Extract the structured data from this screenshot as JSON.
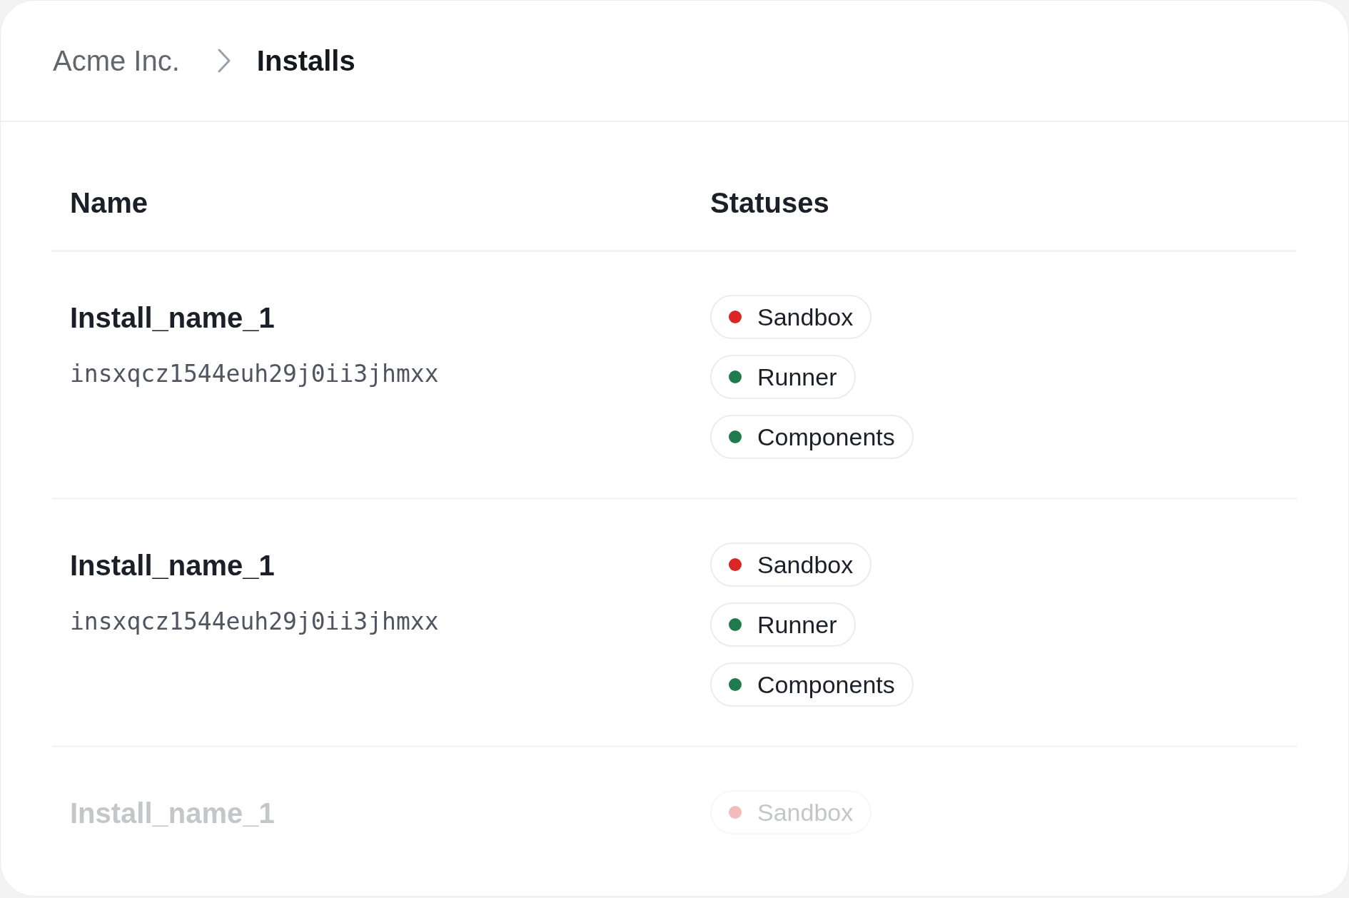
{
  "breadcrumb": {
    "parent": "Acme Inc.",
    "current": "Installs"
  },
  "table": {
    "columns": [
      "Name",
      "Statuses"
    ],
    "rows": [
      {
        "name": "Install_name_1",
        "id": "insxqcz1544euh29j0ii3jhmxx",
        "faded": false,
        "statuses": [
          {
            "label": "Sandbox",
            "color": "#dc2626"
          },
          {
            "label": "Runner",
            "color": "#1f7a4d"
          },
          {
            "label": "Components",
            "color": "#1f7a4d"
          }
        ]
      },
      {
        "name": "Install_name_1",
        "id": "insxqcz1544euh29j0ii3jhmxx",
        "faded": false,
        "statuses": [
          {
            "label": "Sandbox",
            "color": "#dc2626"
          },
          {
            "label": "Runner",
            "color": "#1f7a4d"
          },
          {
            "label": "Components",
            "color": "#1f7a4d"
          }
        ]
      },
      {
        "name": "Install_name_1",
        "faded": true,
        "statuses": [
          {
            "label": "Sandbox",
            "color": "#f2bcbc"
          }
        ]
      }
    ]
  }
}
